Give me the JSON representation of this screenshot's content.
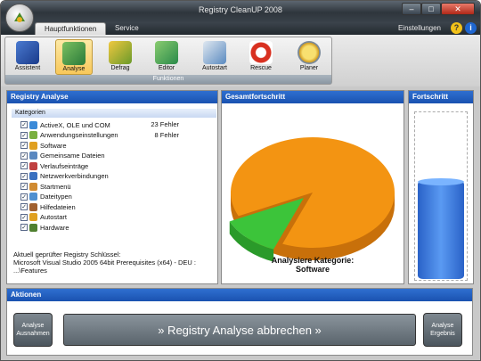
{
  "window": {
    "title": "Registry CleanUP 2008"
  },
  "tabs": [
    {
      "label": "Hauptfunktionen"
    },
    {
      "label": "Service"
    }
  ],
  "header": {
    "settings_label": "Einstellungen"
  },
  "ribbon": {
    "group_label": "Funktionen",
    "buttons": [
      {
        "label": "Assistent"
      },
      {
        "label": "Analyse"
      },
      {
        "label": "Defrag"
      },
      {
        "label": "Editor"
      },
      {
        "label": "Autostart"
      },
      {
        "label": "Rescue"
      },
      {
        "label": "Planer"
      }
    ]
  },
  "analysis": {
    "title": "Registry Analyse",
    "categories_header": "Kategorien",
    "categories": [
      {
        "label": "ActiveX, OLE und COM",
        "errors": "23 Fehler",
        "color": "#3a8ad8"
      },
      {
        "label": "Anwendungseinstellungen",
        "errors": "8 Fehler",
        "color": "#7ab040"
      },
      {
        "label": "Software",
        "errors": "",
        "color": "#e0a020"
      },
      {
        "label": "Gemeinsame Dateien",
        "errors": "",
        "color": "#5a88c0"
      },
      {
        "label": "Verlaufseinträge",
        "errors": "",
        "color": "#c04040"
      },
      {
        "label": "Netzwerkverbindungen",
        "errors": "",
        "color": "#3a70c0"
      },
      {
        "label": "Startmenü",
        "errors": "",
        "color": "#d08a30"
      },
      {
        "label": "Dateitypen",
        "errors": "",
        "color": "#5090d0"
      },
      {
        "label": "Hilfedateien",
        "errors": "",
        "color": "#a06030"
      },
      {
        "label": "Autostart",
        "errors": "",
        "color": "#e0a020"
      },
      {
        "label": "Hardware",
        "errors": "",
        "color": "#508030"
      }
    ],
    "scan_line1": "Aktuell geprüfter Registry Schlüssel:",
    "scan_line2": "Microsoft Visual Studio 2005 64bit Prerequisites (x64) - DEU :",
    "scan_line3": "...\\Features"
  },
  "overall": {
    "title": "Gesamtfortschritt",
    "status_line1": "Analysiere Kategorie:",
    "status_line2": "Software",
    "pie_done_fraction": 0.12,
    "colors": {
      "done": "#3cc43a",
      "remaining": "#f39412"
    }
  },
  "progress": {
    "title": "Fortschritt",
    "fraction": 0.58
  },
  "actions": {
    "title": "Aktionen",
    "left_button": "Analyse Ausnahmen",
    "main_button": "» Registry Analyse abbrechen »",
    "right_button": "Analyse Ergebnis"
  }
}
